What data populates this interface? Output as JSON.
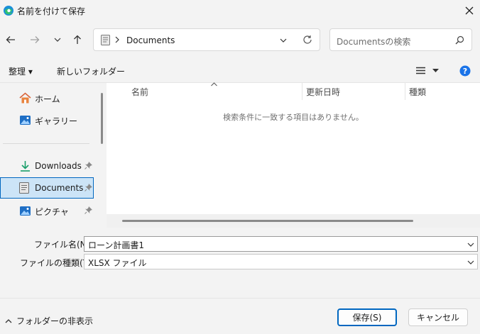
{
  "window": {
    "title": "名前を付けて保存"
  },
  "address": {
    "folder": "Documents"
  },
  "search": {
    "placeholder": "Documentsの検索"
  },
  "toolbar": {
    "organize_label": "整理 ▾",
    "new_folder_label": "新しいフォルダー"
  },
  "sidebar": {
    "items": [
      {
        "label": "ホーム",
        "icon": "home-icon"
      },
      {
        "label": "ギャラリー",
        "icon": "gallery-icon"
      },
      {
        "label": "Downloads",
        "icon": "download-icon",
        "pinned": true
      },
      {
        "label": "Documents",
        "icon": "documents-icon",
        "pinned": true,
        "selected": true
      },
      {
        "label": "ピクチャ",
        "icon": "pictures-icon",
        "pinned": true
      }
    ]
  },
  "file_list": {
    "columns": [
      "名前",
      "更新日時",
      "種類"
    ],
    "empty_message": "検索条件に一致する項目はありません。"
  },
  "form": {
    "filename_label": "ファイル名(N):",
    "filename_value": "ローン計画書1",
    "filetype_label": "ファイルの種類(T):",
    "filetype_value": "XLSX ファイル"
  },
  "footer": {
    "hide_folders_label": "フォルダーの非表示",
    "save_label": "保存(S)",
    "cancel_label": "キャンセル"
  },
  "colors": {
    "accent": "#0067c0",
    "selection": "#cce4f7",
    "help": "#1a73e8"
  }
}
